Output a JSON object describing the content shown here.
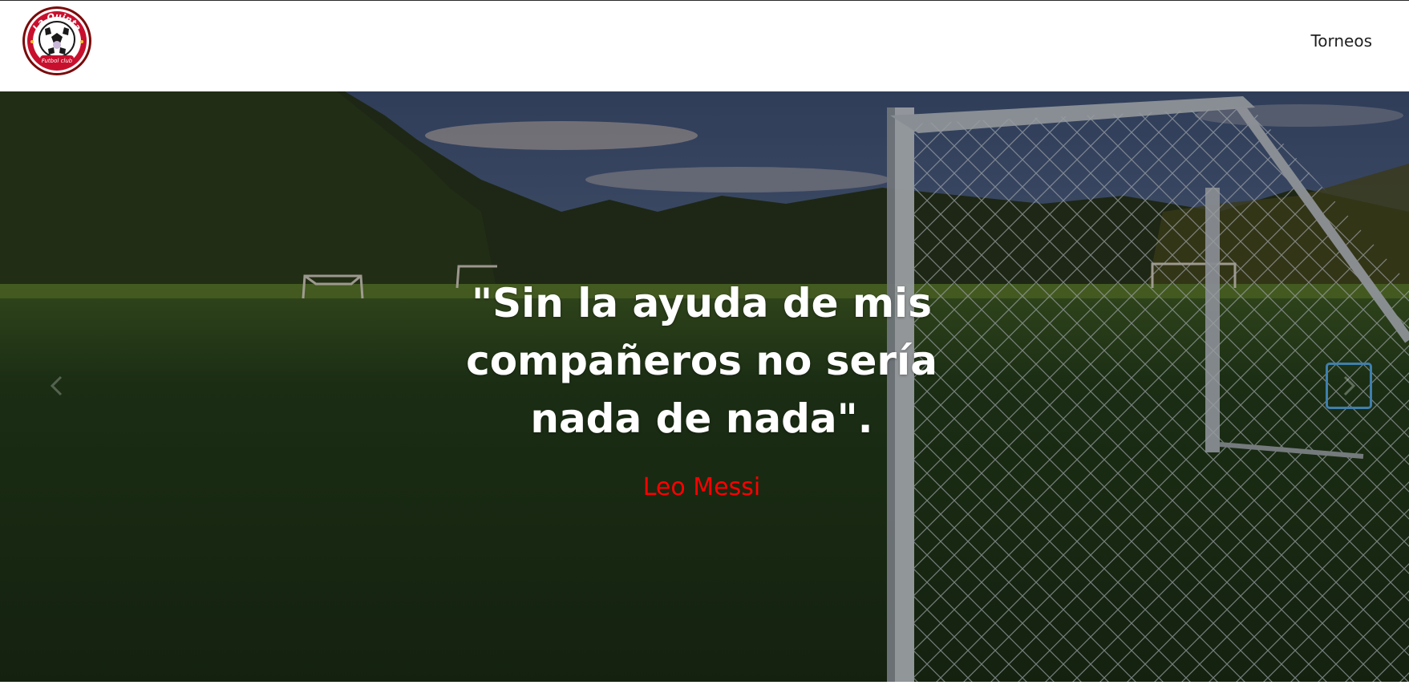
{
  "logo": {
    "text_top": "La Quinta",
    "text_bottom": "Futbol club",
    "icon": "soccer-ball-logo-icon",
    "colors": {
      "ring": "#c8102e",
      "ball_dark": "#1a1a1a",
      "ball_light": "#ffffff"
    }
  },
  "nav": {
    "items": [
      {
        "label": "Torneos"
      }
    ]
  },
  "carousel": {
    "slide": {
      "quote": "\"Sin la ayuda de mis compañeros no sería nada de nada\".",
      "author": "Leo Messi"
    },
    "controls": {
      "prev_icon": "chevron-left-icon",
      "next_icon": "chevron-right-icon"
    },
    "colors": {
      "author": "#ff0000",
      "quote": "#ffffff",
      "focus_ring": "#3f7fae"
    }
  }
}
